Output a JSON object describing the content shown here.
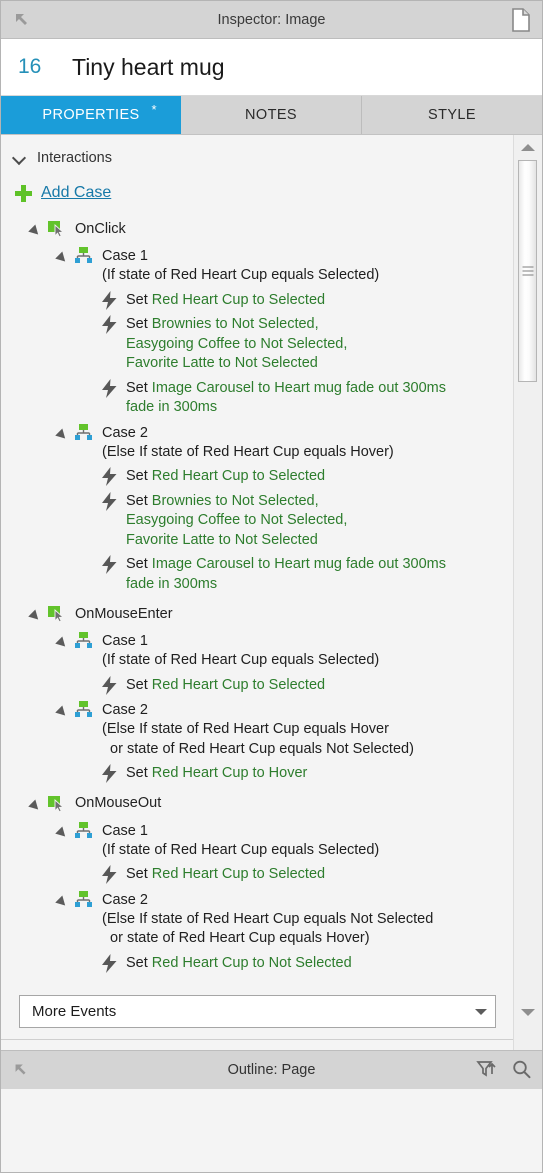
{
  "titlebar": {
    "title": "Inspector: Image",
    "left_icon": "collapse-arrow-icon",
    "right_icon": "page-icon"
  },
  "name_row": {
    "index": "16",
    "name": "Tiny heart mug"
  },
  "tabs": [
    {
      "label": "PROPERTIES",
      "active": true,
      "modified_marker": "*"
    },
    {
      "label": "NOTES",
      "active": false,
      "modified_marker": ""
    },
    {
      "label": "STYLE",
      "active": false,
      "modified_marker": ""
    }
  ],
  "section": {
    "title": "Interactions",
    "add_case_label": "Add Case"
  },
  "events": [
    {
      "name": "OnClick",
      "cases": [
        {
          "name": "Case 1",
          "condition": "(If state of Red Heart Cup equals Selected)",
          "actions": [
            {
              "verb": "Set ",
              "target": "Red Heart Cup to Selected"
            },
            {
              "verb": "Set ",
              "target": "Brownies to Not Selected,\nEasygoing Coffee to Not Selected,\nFavorite Latte to Not Selected"
            },
            {
              "verb": "Set ",
              "target": "Image Carousel to Heart mug fade out 300ms\nfade in 300ms"
            }
          ]
        },
        {
          "name": "Case 2",
          "condition": "(Else If state of Red Heart Cup equals Hover)",
          "actions": [
            {
              "verb": "Set ",
              "target": "Red Heart Cup to Selected"
            },
            {
              "verb": "Set ",
              "target": "Brownies to Not Selected,\nEasygoing Coffee to Not Selected,\nFavorite Latte to Not Selected"
            },
            {
              "verb": "Set ",
              "target": "Image Carousel to Heart mug fade out 300ms\nfade in 300ms"
            }
          ]
        }
      ]
    },
    {
      "name": "OnMouseEnter",
      "cases": [
        {
          "name": "Case 1",
          "condition": "(If state of Red Heart Cup equals Selected)",
          "actions": [
            {
              "verb": "Set ",
              "target": "Red Heart Cup to Selected"
            }
          ]
        },
        {
          "name": "Case 2",
          "condition": "(Else If state of Red Heart Cup equals Hover\n  or state of Red Heart Cup equals Not Selected)",
          "actions": [
            {
              "verb": "Set ",
              "target": "Red Heart Cup to Hover"
            }
          ]
        }
      ]
    },
    {
      "name": "OnMouseOut",
      "cases": [
        {
          "name": "Case 1",
          "condition": "(If state of Red Heart Cup equals Selected)",
          "actions": [
            {
              "verb": "Set ",
              "target": "Red Heart Cup to Selected"
            }
          ]
        },
        {
          "name": "Case 2",
          "condition": "(Else If state of Red Heart Cup equals Not Selected\n  or state of Red Heart Cup equals Hover)",
          "actions": [
            {
              "verb": "Set ",
              "target": "Red Heart Cup to Not Selected"
            }
          ]
        }
      ]
    }
  ],
  "more_events": {
    "value": "More Events"
  },
  "statusbar": {
    "text": "Outline: Page",
    "left_icon": "collapse-arrow-icon",
    "filter_icon": "filter-up-icon",
    "search_icon": "search-icon"
  },
  "colors": {
    "accent_tab": "#1b9dd9",
    "link": "#1779a8",
    "index_number": "#2590b8",
    "action_green": "#2d7d2d",
    "plus_green": "#5ec227",
    "chrome": "#d4d4d4",
    "panel_bg": "#f4f4f4"
  }
}
